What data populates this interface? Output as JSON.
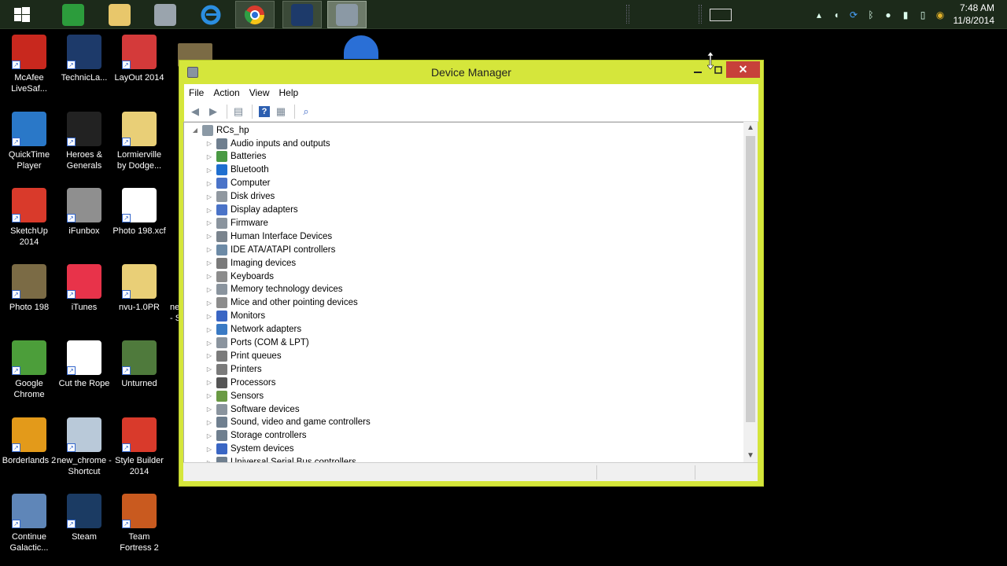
{
  "taskbar": {
    "apps": [
      {
        "icon": "windows-start-icon",
        "color": "#ffffff"
      },
      {
        "icon": "store-icon",
        "color": "#2c9c3c"
      },
      {
        "icon": "file-explorer-icon",
        "color": "#e8c76b"
      },
      {
        "icon": "user-folder-icon",
        "color": "#9aa4ad"
      },
      {
        "icon": "internet-explorer-icon",
        "color": "#2b8ee0"
      },
      {
        "icon": "chrome-icon",
        "color": "#d93b2e"
      },
      {
        "icon": "technic-launcher-icon",
        "color": "#1d3a6a"
      },
      {
        "icon": "device-manager-icon",
        "color": "#8b99a5"
      }
    ],
    "clock": {
      "time": "7:48 AM",
      "date": "11/8/2014"
    }
  },
  "desktop": {
    "icons": [
      {
        "label": "McAfee LiveSaf...",
        "icon": "mcafee-icon",
        "color": "#c8281e"
      },
      {
        "label": "TechnicLa...",
        "icon": "technic-launcher-icon",
        "color": "#1d3a6a"
      },
      {
        "label": "LayOut 2014",
        "icon": "layout-icon",
        "color": "#d43a3a"
      },
      {
        "label": "QuickTime Player",
        "icon": "quicktime-icon",
        "color": "#2a78c8"
      },
      {
        "label": "Heroes & Generals",
        "icon": "heroes-generals-icon",
        "color": "#222222"
      },
      {
        "label": "Lormierville by Dodge...",
        "icon": "folder-icon",
        "color": "#e9cf77"
      },
      {
        "label": "SketchUp 2014",
        "icon": "sketchup-icon",
        "color": "#d93a2b"
      },
      {
        "label": "iFunbox",
        "icon": "ifunbox-icon",
        "color": "#8f8f8f"
      },
      {
        "label": "Photo 198.xcf",
        "icon": "file-icon",
        "color": "#ffffff"
      },
      {
        "label": "Photo 198",
        "icon": "photo-icon",
        "color": "#7b6b45"
      },
      {
        "label": "iTunes",
        "icon": "itunes-icon",
        "color": "#e8334a"
      },
      {
        "label": "nvu-1.0PR",
        "icon": "folder-icon",
        "color": "#e9cf77"
      },
      {
        "label": "Google Chrome",
        "icon": "chrome-icon",
        "color": "#4c9e3a"
      },
      {
        "label": "Cut the Rope",
        "icon": "file-icon",
        "color": "#ffffff"
      },
      {
        "label": "Unturned",
        "icon": "unturned-icon",
        "color": "#4f7a3c"
      },
      {
        "label": "Borderlands 2",
        "icon": "borderlands-icon",
        "color": "#e39a1a"
      },
      {
        "label": "new_chrome - Shortcut",
        "icon": "shortcut-file-icon",
        "color": "#b9c9d9"
      },
      {
        "label": "Style Builder 2014",
        "icon": "style-builder-icon",
        "color": "#d93a2b"
      },
      {
        "label": "Continue Galactic...",
        "icon": "continue-icon",
        "color": "#5f86b8"
      },
      {
        "label": "Steam",
        "icon": "steam-icon",
        "color": "#1b3b63"
      },
      {
        "label": "Team Fortress 2",
        "icon": "tf2-icon",
        "color": "#c95a1f"
      }
    ],
    "partial_labels": [
      "ne",
      "- S"
    ]
  },
  "window": {
    "title": "Device Manager",
    "menu": [
      "File",
      "Action",
      "View",
      "Help"
    ],
    "root": "RCs_hp",
    "items": [
      {
        "label": "Audio inputs and outputs",
        "icon": "speaker-icon",
        "color": "#6f7f8f"
      },
      {
        "label": "Batteries",
        "icon": "battery-icon",
        "color": "#4a9a44"
      },
      {
        "label": "Bluetooth",
        "icon": "bluetooth-icon",
        "color": "#1f6fd0"
      },
      {
        "label": "Computer",
        "icon": "computer-icon",
        "color": "#4a73c8"
      },
      {
        "label": "Disk drives",
        "icon": "disk-drive-icon",
        "color": "#9098a0"
      },
      {
        "label": "Display adapters",
        "icon": "display-adapter-icon",
        "color": "#4a73c8"
      },
      {
        "label": "Firmware",
        "icon": "firmware-icon",
        "color": "#8a949e"
      },
      {
        "label": "Human Interface Devices",
        "icon": "hid-icon",
        "color": "#7a848e"
      },
      {
        "label": "IDE ATA/ATAPI controllers",
        "icon": "ide-controller-icon",
        "color": "#6c8aa6"
      },
      {
        "label": "Imaging devices",
        "icon": "camera-icon",
        "color": "#7a7a7a"
      },
      {
        "label": "Keyboards",
        "icon": "keyboard-icon",
        "color": "#8c8c8c"
      },
      {
        "label": "Memory technology devices",
        "icon": "memory-icon",
        "color": "#8a949e"
      },
      {
        "label": "Mice and other pointing devices",
        "icon": "mouse-icon",
        "color": "#8c8c8c"
      },
      {
        "label": "Monitors",
        "icon": "monitor-icon",
        "color": "#3a66c4"
      },
      {
        "label": "Network adapters",
        "icon": "network-icon",
        "color": "#3a7ac4"
      },
      {
        "label": "Ports (COM & LPT)",
        "icon": "port-icon",
        "color": "#8a949e"
      },
      {
        "label": "Print queues",
        "icon": "print-queue-icon",
        "color": "#7b7b7b"
      },
      {
        "label": "Printers",
        "icon": "printer-icon",
        "color": "#7b7b7b"
      },
      {
        "label": "Processors",
        "icon": "processor-icon",
        "color": "#555555"
      },
      {
        "label": "Sensors",
        "icon": "sensor-icon",
        "color": "#6a9a44"
      },
      {
        "label": "Software devices",
        "icon": "software-device-icon",
        "color": "#8a949e"
      },
      {
        "label": "Sound, video and game controllers",
        "icon": "sound-icon",
        "color": "#6f7f8f"
      },
      {
        "label": "Storage controllers",
        "icon": "storage-controller-icon",
        "color": "#6f7f8f"
      },
      {
        "label": "System devices",
        "icon": "system-device-icon",
        "color": "#3a66c4"
      },
      {
        "label": "Universal Serial Bus controllers",
        "icon": "usb-icon",
        "color": "#6f7f8f"
      }
    ]
  }
}
